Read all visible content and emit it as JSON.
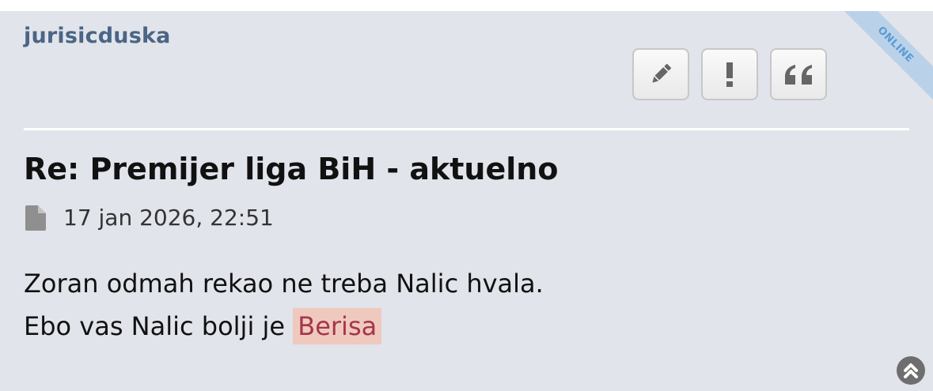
{
  "post": {
    "username": "jurisicduska",
    "status": "ONLINE",
    "title": "Re: Premijer liga BiH - aktuelno",
    "date": "17 jan 2026, 22:51",
    "content": {
      "line1": "Zoran odmah rekao ne treba Nalic hvala.",
      "line2_prefix": "Ebo vas Nalic bolji je ",
      "line2_highlight": "Berisa"
    },
    "buttons": {
      "edit_icon": "pencil-icon",
      "report_icon": "exclamation-icon",
      "quote_icon": "quote-icon"
    }
  },
  "icons": {
    "post_icon": "file-icon",
    "scroll_top_icon": "chevron-up-icon"
  },
  "colors": {
    "username": "#4a6585",
    "post_background": "#e1e4ea",
    "online_ribbon": "#b9d2e9",
    "highlight_bg": "#efc9bd",
    "highlight_text": "#a6354c"
  }
}
